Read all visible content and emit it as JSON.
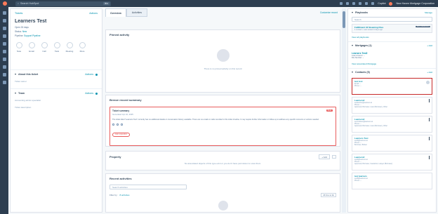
{
  "topbar": {
    "search_placeholder": "Search HubSpot",
    "shortcut": "⌘K",
    "copilot": "Copilot",
    "account_name": "New Haven Mortgage Corporation"
  },
  "record": {
    "back_link": "Tickets",
    "actions_label": "Actions",
    "name": "Learners Test",
    "open_days": "Open 26 days",
    "status_label": "Status:",
    "status_value": "New",
    "pipeline_label": "Pipeline:",
    "pipeline_value": "Support Pipeline",
    "action_buttons": [
      "Note",
      "Email",
      "Call",
      "Task",
      "Meeting",
      "More"
    ],
    "sections": [
      {
        "title": "About this ticket",
        "actions": "Actions",
        "body": "Ticket owner"
      },
      {
        "title": "Team",
        "actions": "Actions",
        "body": "Accounting admin specialist"
      }
    ],
    "extra_line": "Ticket description"
  },
  "center": {
    "tabs": [
      "Overview",
      "Activities"
    ],
    "customize_link": "Customize record",
    "pinned": {
      "title": "Pinned activity",
      "empty_text": "There is no pinned activity on this record"
    },
    "summary": {
      "title": "Breeze record summary",
      "inner_title": "Ticket summary",
      "date": "Generated Apr 22, 2025",
      "badge": "Beta",
      "text": "The ticket titled \"Learners Test\" currently has no additional details or conversation history available. There are no emails or calls recorded in this ticket timeline. It may require further information or follow-up to address any specific concerns or actions needed.",
      "button": "Ask a question"
    },
    "property": {
      "title": "Property",
      "add": "+ Add",
      "empty_text": "No associated objects of this type exist or you don't have permission to view them."
    },
    "recent": {
      "title": "Recent activities",
      "search_placeholder": "Search activities",
      "filter_label": "Filter by:",
      "filter_value": "8 activities",
      "timezone": "All time so far"
    }
  },
  "right": {
    "playbooks": {
      "title": "Playbooks",
      "manage": "Manage",
      "search_placeholder": "Search",
      "item_title": "Fulfillment #2 Steaming Files",
      "item_sub": "1 contact • Last viewed 4 days ago",
      "item_btn": "RECOMMENDED",
      "view_all": "View all playbooks"
    },
    "mortgages": {
      "title": "Mortgages (1)",
      "add": "+ Add",
      "name": "Learners Test2",
      "loan_label": "Loan Amount: --",
      "file_label": "File Number: --",
      "view_link": "View associated Mortgage"
    },
    "contacts": {
      "title": "Contacts (5)",
      "add": "+ Add",
      "items": [
        {
          "name": "test test",
          "line1": "Email: --",
          "line2": "Phone: --"
        },
        {
          "name": "Learners2",
          "line1": "testlearner@learners.ai",
          "line2": "Phone: --",
          "line3": "Approved, Borrower, Loan (Borrower), Other"
        },
        {
          "name": "Learners2",
          "line1": "seconduser@learners.ai",
          "line2": "Phone: --",
          "line3": "Approved, Borrower, Loan (Borrower), Other"
        },
        {
          "name": "Learners Test",
          "line1": "test3@learners.ai",
          "line2": "Phone: --",
          "line3": "Borrower, Broker"
        },
        {
          "name": "Learners2",
          "line1": "test4@learners.ai",
          "line2": "Phone: --",
          "line3": "Approved, Borrower, Guarantor, Lawyer (Borrower)"
        },
        {
          "name": "test learners",
          "line1": "test5@learners.ai",
          "line2": "Phone: --"
        }
      ]
    }
  }
}
